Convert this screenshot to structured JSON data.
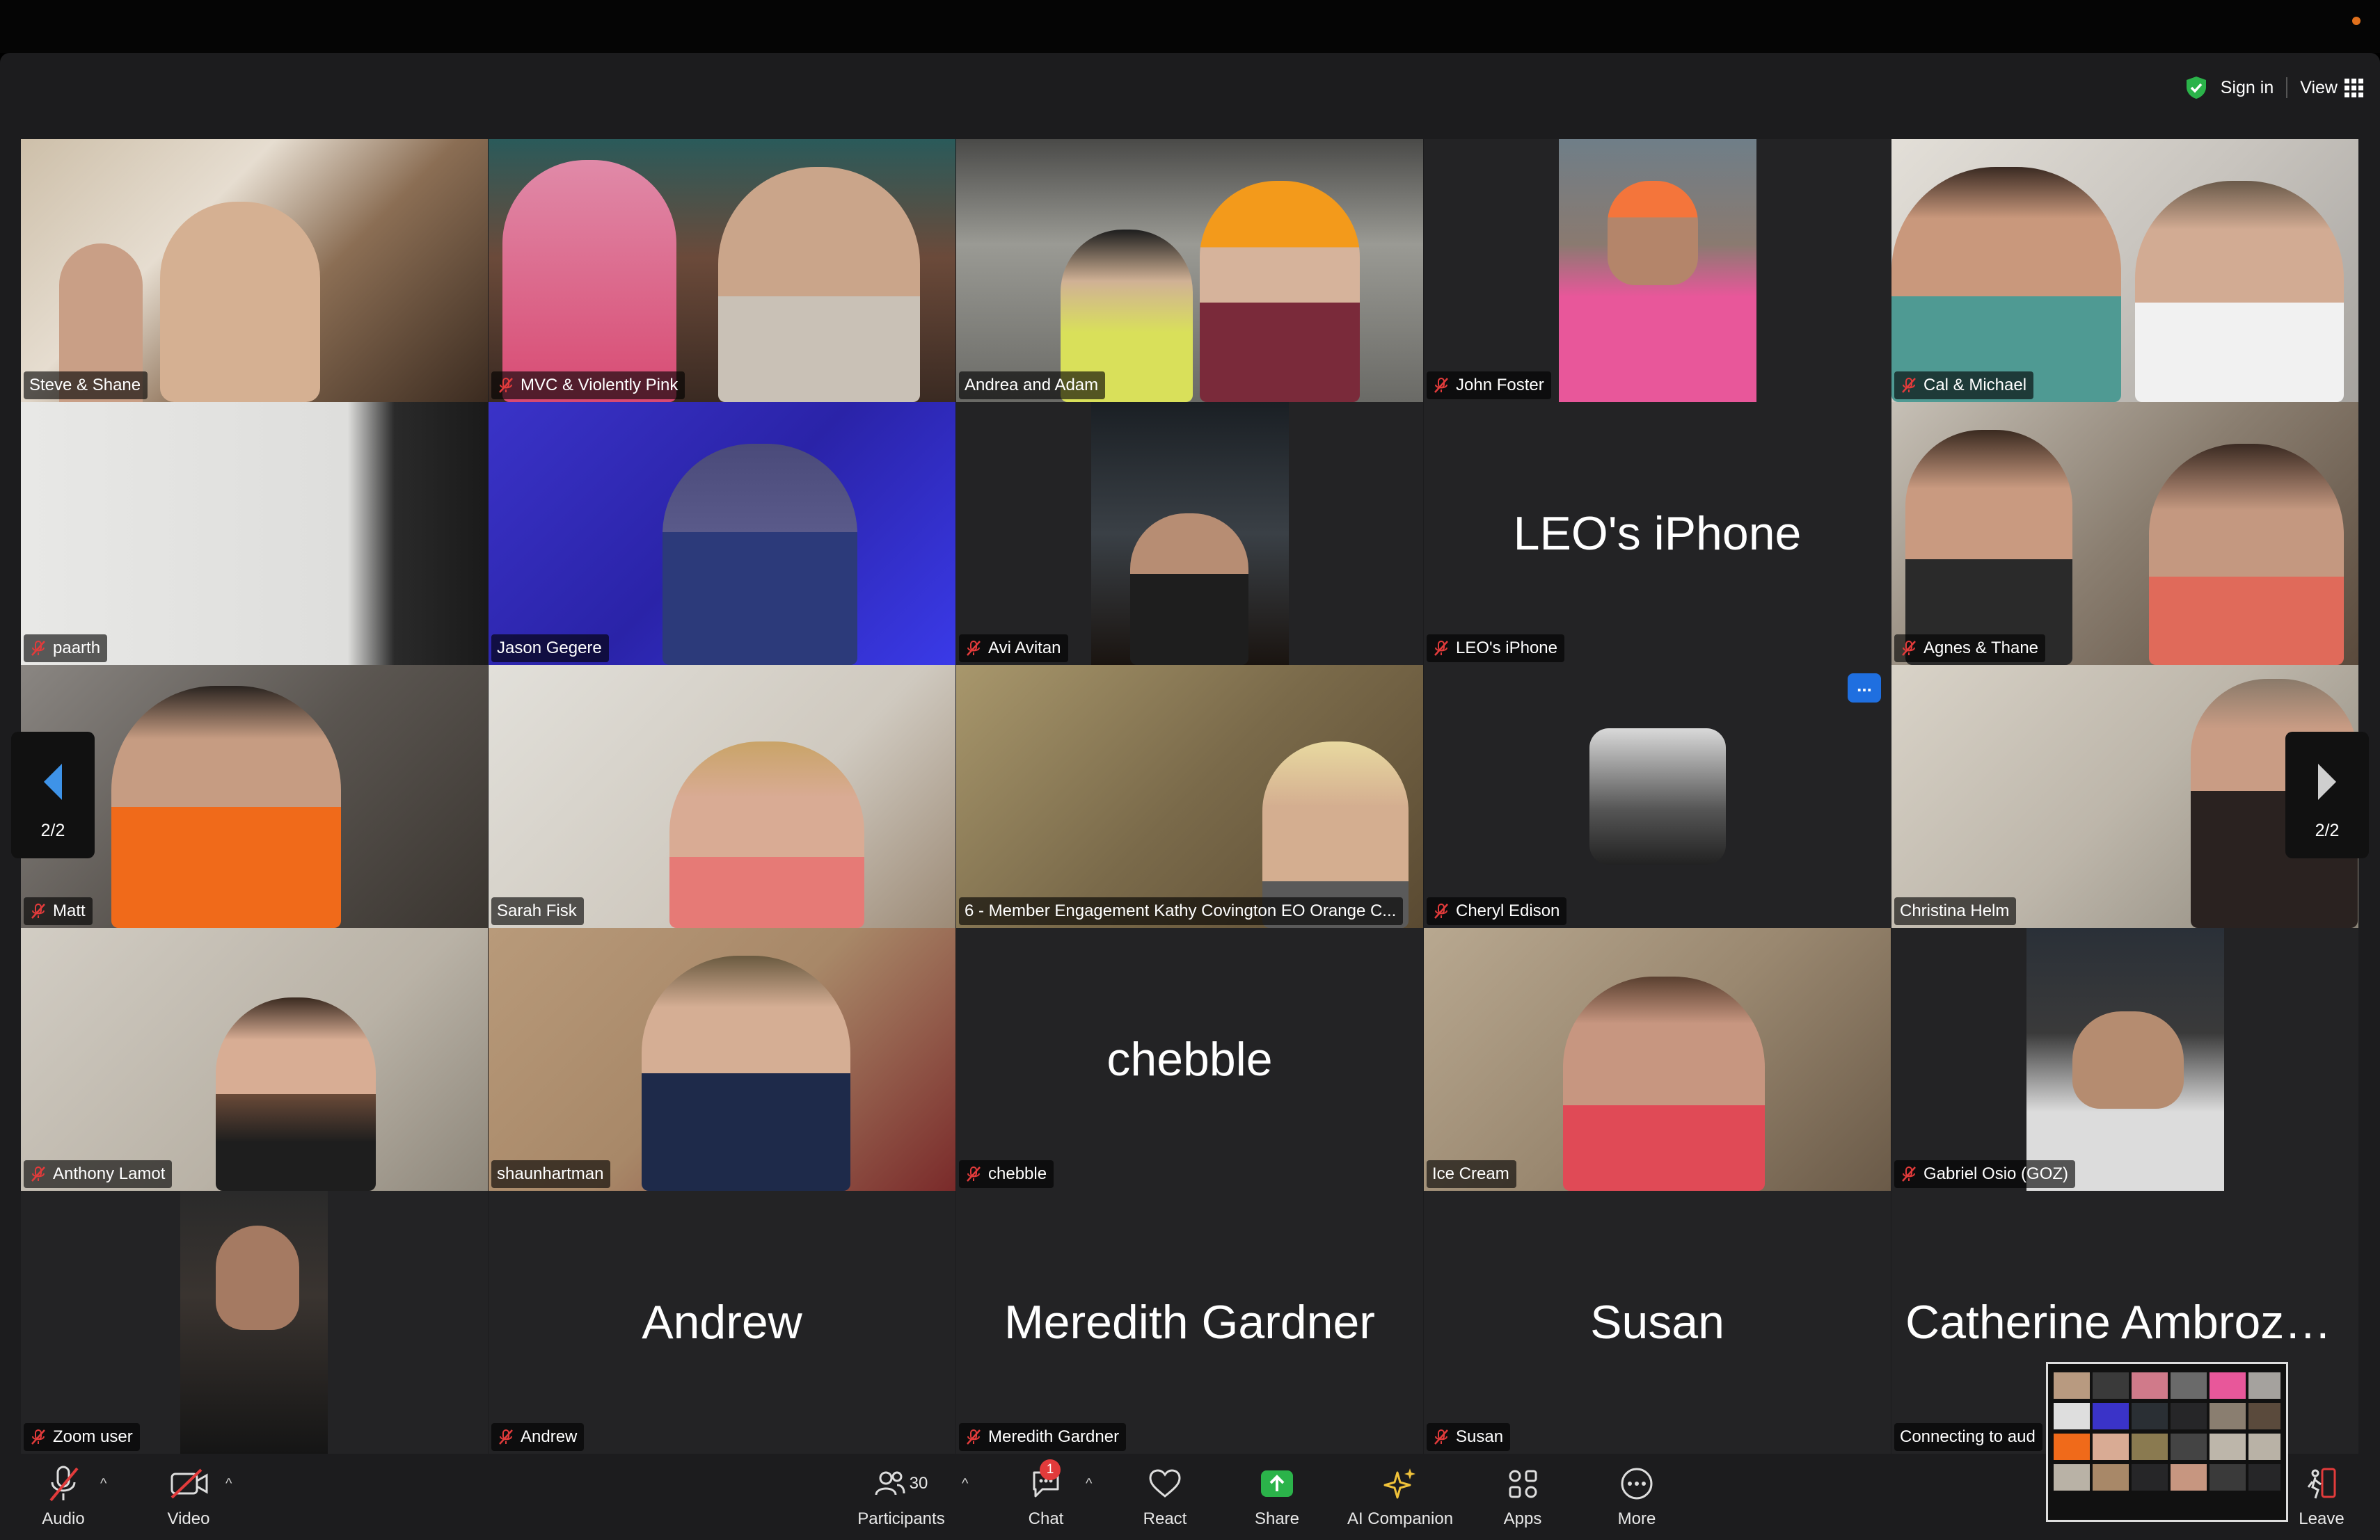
{
  "header": {
    "sign_in": "Sign in",
    "view": "View"
  },
  "pager": {
    "page": "2/2"
  },
  "tiles": {
    "t1": {
      "label": "Steve & Shane"
    },
    "t2": {
      "label": "MVC & Violently Pink"
    },
    "t3": {
      "label": "Andrea and Adam"
    },
    "t4": {
      "label": "John Foster"
    },
    "t5": {
      "label": "Cal & Michael"
    },
    "t6": {
      "label": "paarth"
    },
    "t7": {
      "label": "Jason Gegere"
    },
    "t8": {
      "label": "Avi Avitan"
    },
    "t9": {
      "label": "LEO's iPhone",
      "display": "LEO's iPhone"
    },
    "t10": {
      "label": "Agnes & Thane"
    },
    "t11": {
      "label": "Matt"
    },
    "t12": {
      "label": "Sarah Fisk"
    },
    "t13": {
      "label": "6 - Member Engagement Kathy Covington EO Orange C..."
    },
    "t14": {
      "label": "Cheryl Edison",
      "more": "..."
    },
    "t15": {
      "label": "Christina Helm"
    },
    "t16": {
      "label": "Anthony Lamot"
    },
    "t17": {
      "label": "shaunhartman"
    },
    "t18": {
      "label": "chebble",
      "display": "chebble"
    },
    "t19": {
      "label": "Ice Cream"
    },
    "t20": {
      "label": "Gabriel Osio (GOZ)"
    },
    "t21": {
      "label": "Zoom user"
    },
    "t22": {
      "label": "Andrew",
      "display": "Andrew"
    },
    "t23": {
      "label": "Meredith Gardner",
      "display": "Meredith Gardner"
    },
    "t24": {
      "label": "Susan",
      "display": "Susan"
    },
    "t25": {
      "label": "Connecting to aud",
      "display": "Catherine Ambroze..."
    }
  },
  "toolbar": {
    "audio": "Audio",
    "video": "Video",
    "participants": "Participants",
    "participants_count": "30",
    "chat": "Chat",
    "chat_badge": "1",
    "react": "React",
    "share": "Share",
    "ai_companion": "AI Companion",
    "apps": "Apps",
    "more": "More",
    "leave": "Leave"
  },
  "colors": {
    "active_speaker": "#3ed14a",
    "share_green": "#2bb34a",
    "leave_red": "#e23b3b",
    "more_blue": "#1f6fe0"
  }
}
